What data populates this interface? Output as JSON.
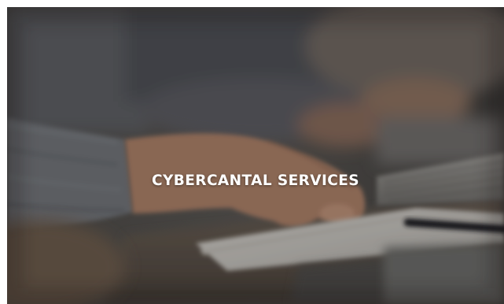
{
  "hero": {
    "title": "CYBERCANTAL SERVICES",
    "image_subject": "office-workers-typing-at-desk"
  },
  "colors": {
    "title_text": "#ffffff",
    "overlay": "rgba(0,0,0,0.18)",
    "desk": "#5c5248",
    "sweater": "#6a6d72",
    "skin": "#a57c64",
    "paper": "#c8c5bf"
  }
}
